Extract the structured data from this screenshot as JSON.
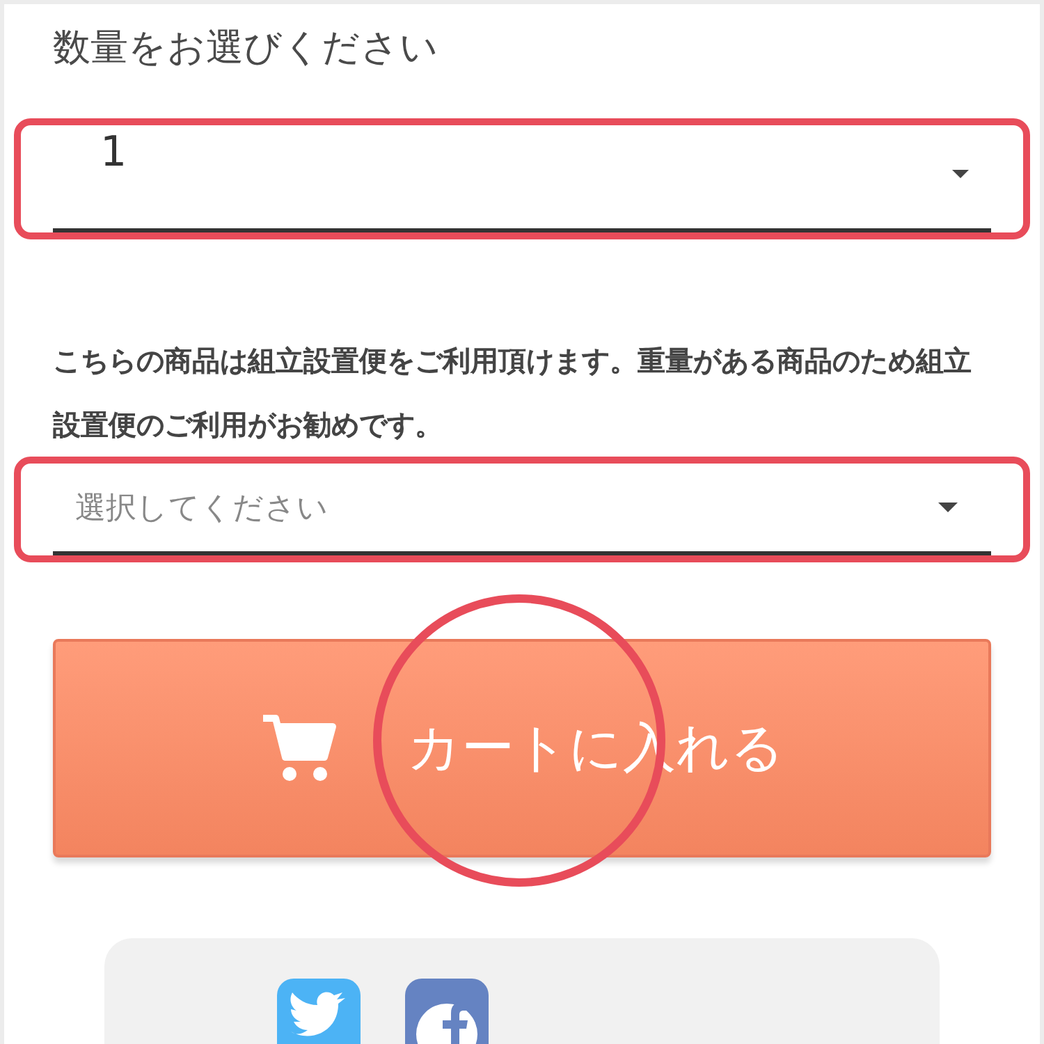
{
  "heading": "数量をお選びください",
  "quantity_select": {
    "value": "1"
  },
  "note": "こちらの商品は組立設置便をご利用頂けます。重量がある商品のため組立設置便のご利用がお勧めです。",
  "delivery_select": {
    "placeholder": "選択してください"
  },
  "cart_button": {
    "label": "カートに入れる"
  }
}
